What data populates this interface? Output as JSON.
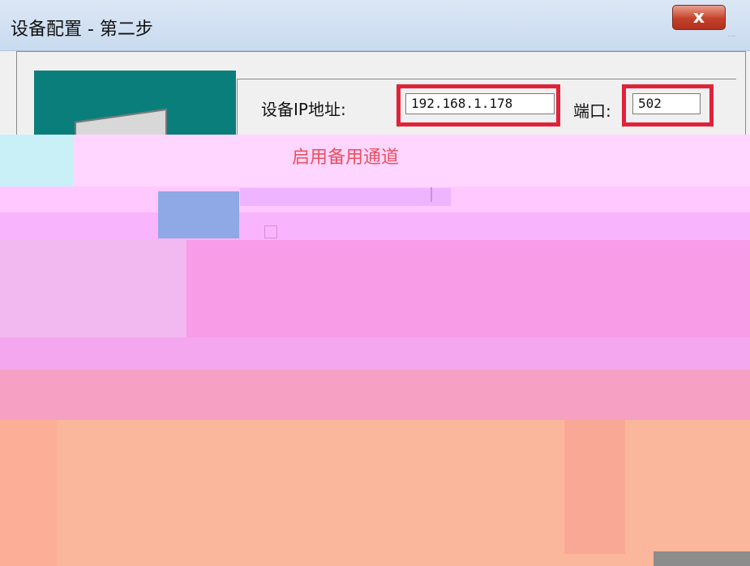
{
  "window": {
    "title": "设备配置 - 第二步",
    "close_label": "x"
  },
  "form": {
    "ip_label": "设备IP地址:",
    "ip_value": "192.168.1.178",
    "port_label": "端口:",
    "port_value": "502",
    "backup_channel_label": "启用备用通道"
  },
  "colors": {
    "highlight": "#e0223a",
    "illustration_bg": "#0a7e7a",
    "backup_text": "#e85060"
  }
}
